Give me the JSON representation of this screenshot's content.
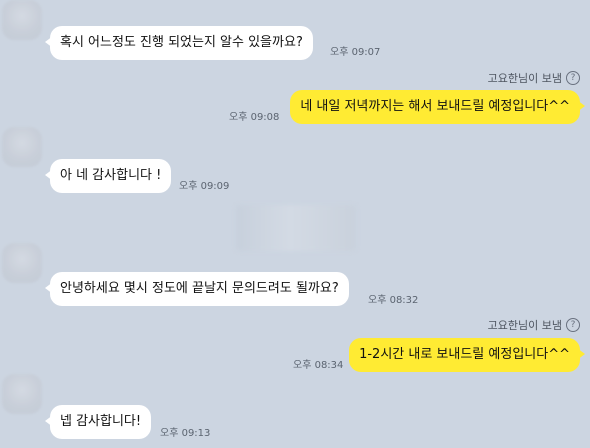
{
  "messages": [
    {
      "text": "혹시 어느정도 진행 되었는지 알수 있을까요?",
      "time": "오후 09:07"
    },
    {
      "sender_label": "고요한님이 보냄",
      "help_icon": "?",
      "text": "네 내일 저녁까지는 해서 보내드릴 예정입니다^^",
      "time": "오후 09:08"
    },
    {
      "text": "아 네 감사합니다 !",
      "time": "오후 09:09"
    },
    {
      "text": "안녕하세요 몇시 정도에 끝날지 문의드려도 될까요?",
      "time": "오후 08:32"
    },
    {
      "sender_label": "고요한님이 보냄",
      "help_icon": "?",
      "text": "1-2시간 내로 보내드릴 예정입니다^^",
      "time": "오후 08:34"
    },
    {
      "text": "넵 감사합니다!",
      "time": "오후 09:13"
    }
  ],
  "colors": {
    "background": "#ccd5e1",
    "incoming_bubble": "#ffffff",
    "outgoing_bubble": "#ffeb33"
  }
}
